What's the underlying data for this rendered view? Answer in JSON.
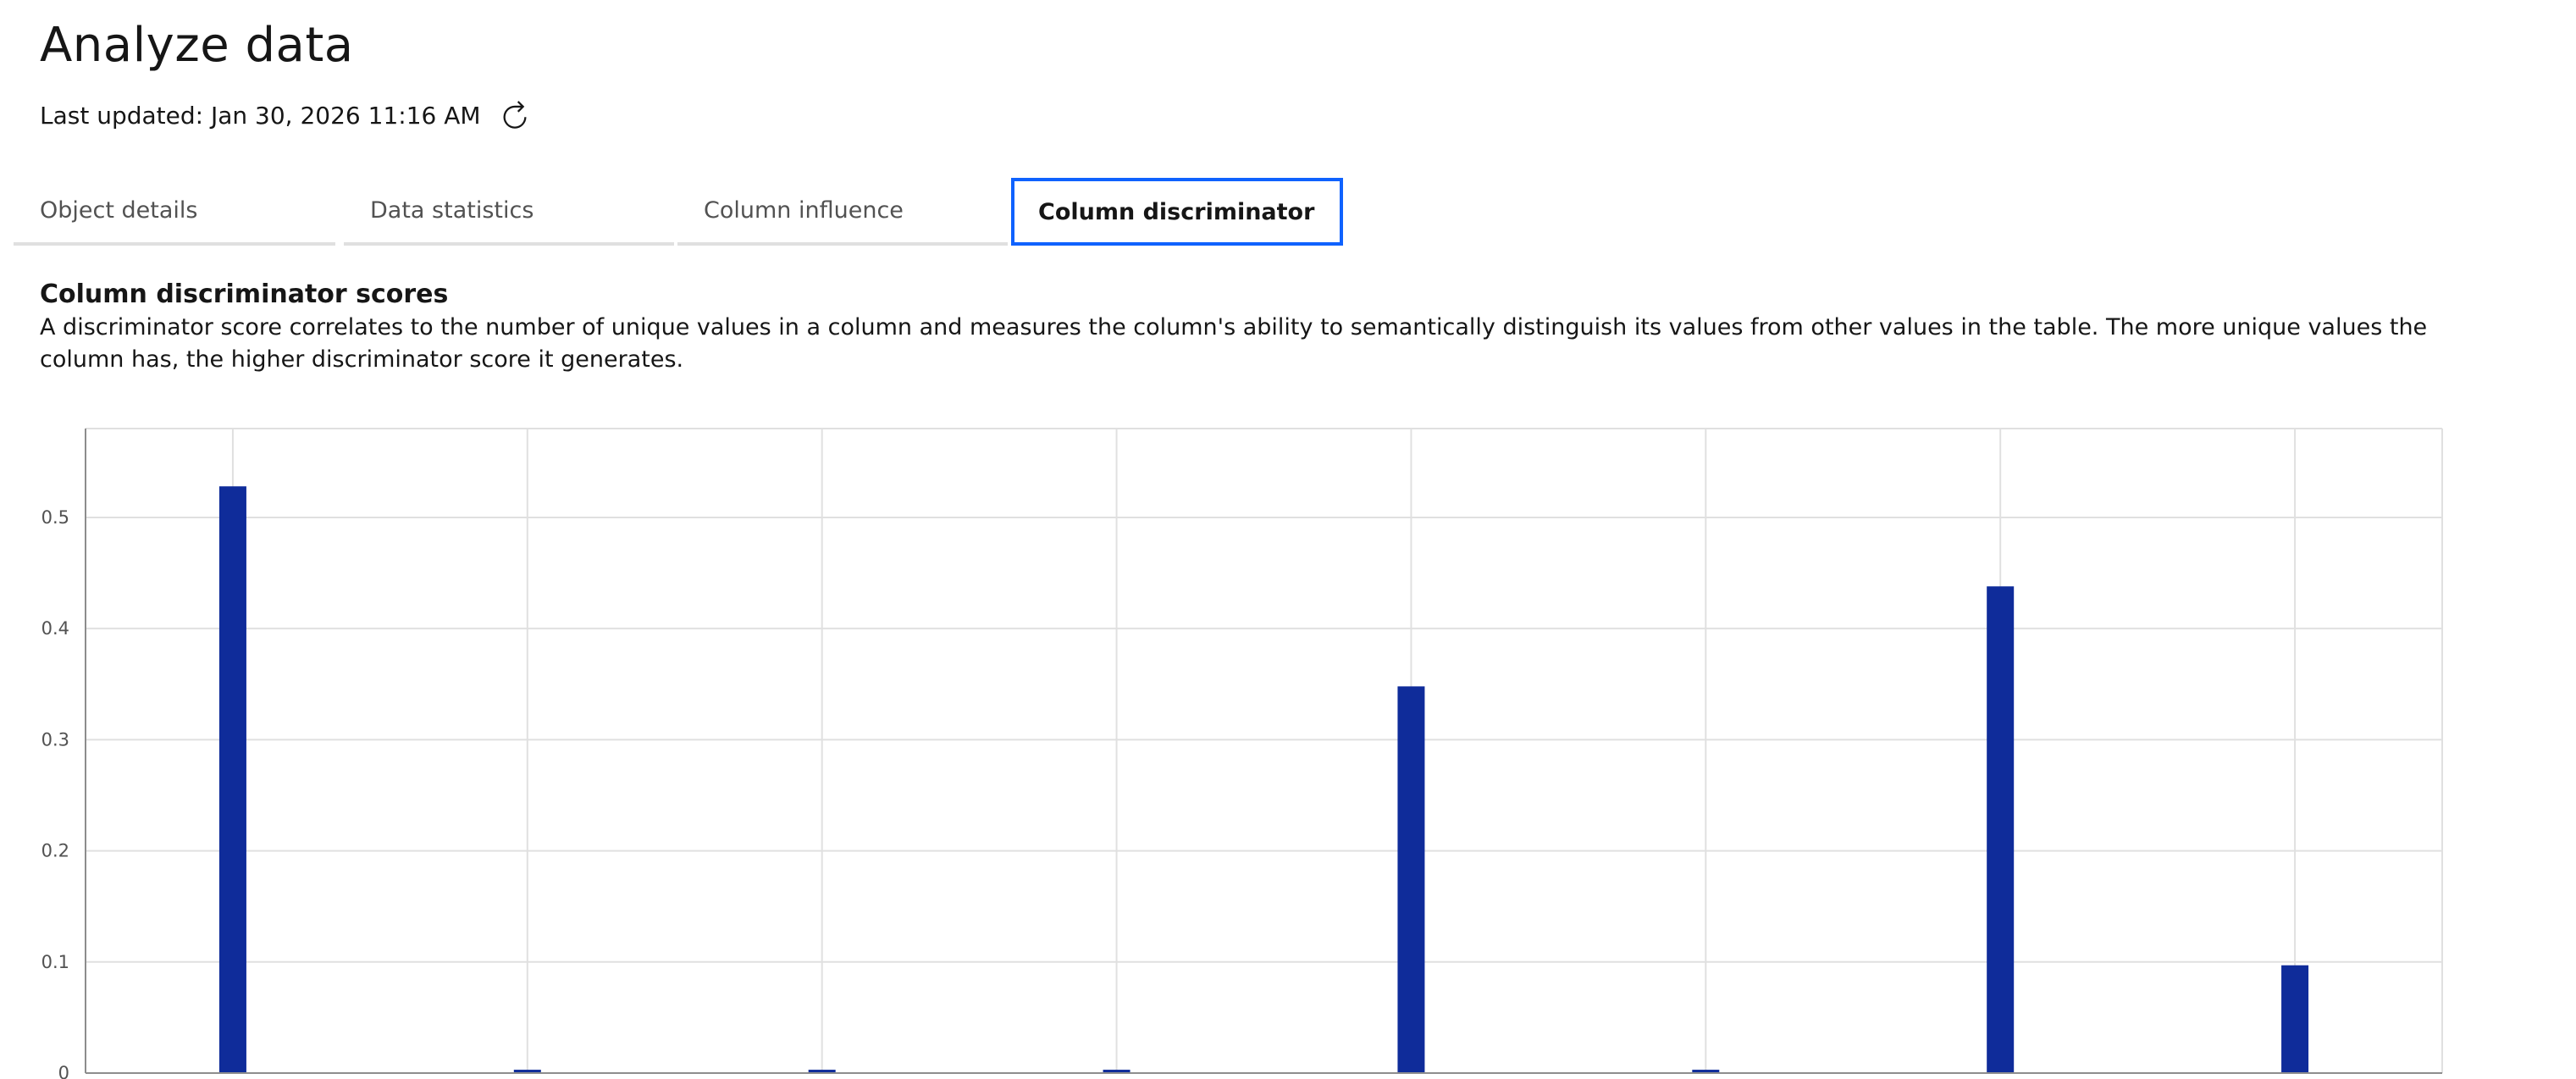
{
  "header": {
    "title": "Analyze data",
    "last_updated": "Last updated: Jan 30, 2026 11:16 AM",
    "refresh_icon": "refresh-icon"
  },
  "tabs": [
    {
      "label": "Object details",
      "active": false
    },
    {
      "label": "Data statistics",
      "active": false
    },
    {
      "label": "Column influence",
      "active": false
    },
    {
      "label": "Column discriminator",
      "active": true
    }
  ],
  "section": {
    "title": "Column discriminator scores",
    "description": "A discriminator score correlates to the number of unique values in a column and measures the column's ability to semantically distinguish its values from other values in the table. The more unique values the column has, the higher discriminator score it generates."
  },
  "colors": {
    "bar": "#0f2c9a",
    "accent": "#0f62fe",
    "grid": "#e0e0e0",
    "axis": "#8d8d8d"
  },
  "chart_data": {
    "type": "bar",
    "values": [
      0.528,
      0.003,
      0.003,
      0.003,
      0.348,
      0.003,
      0.438,
      0.097
    ],
    "yticks": [
      0,
      0.1,
      0.2,
      0.3,
      0.4,
      0.5
    ],
    "ylim": [
      0,
      0.58
    ],
    "grid": true
  }
}
